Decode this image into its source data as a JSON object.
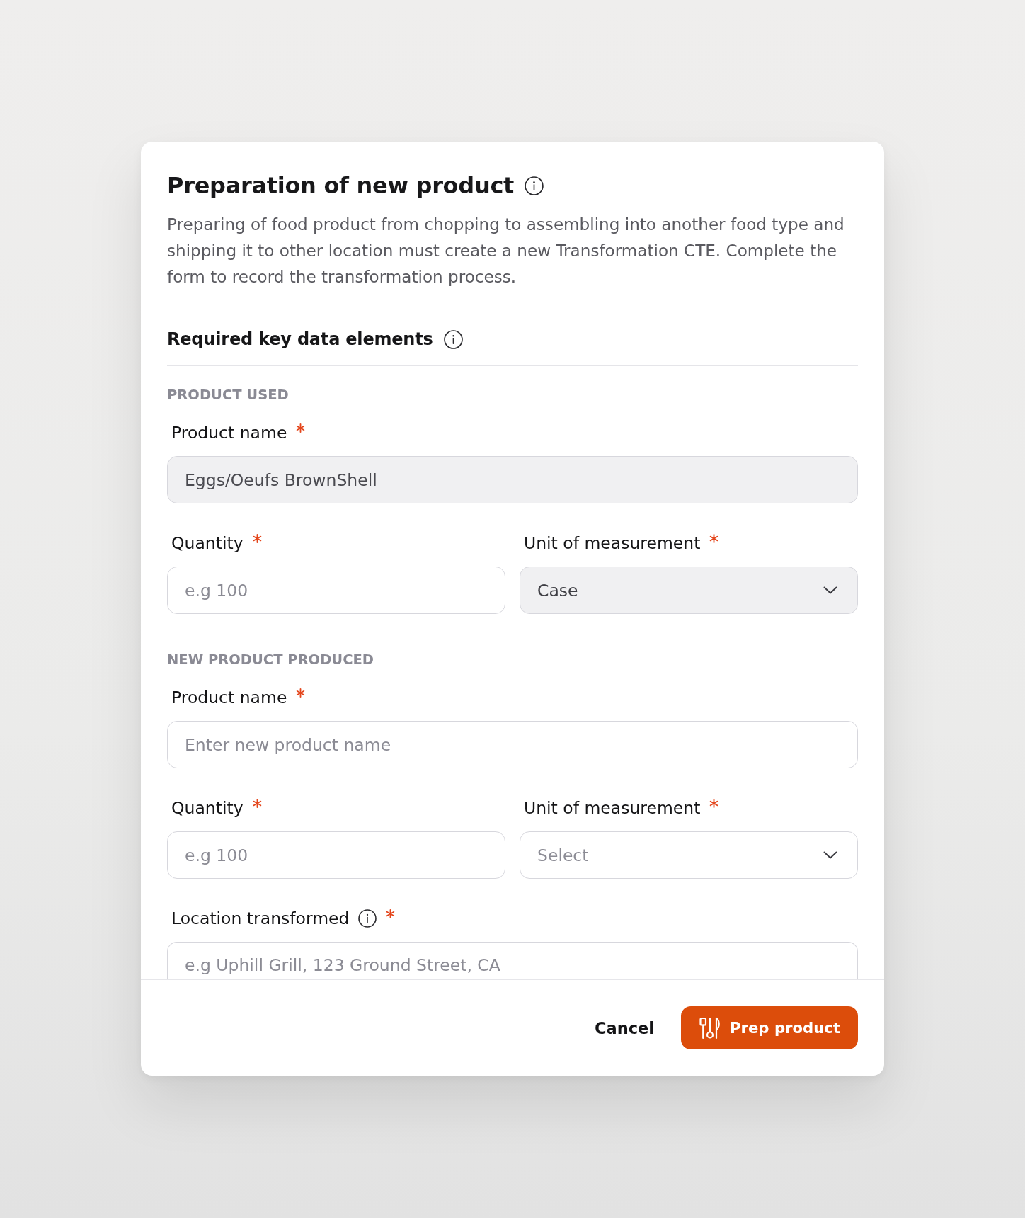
{
  "dialog": {
    "title": "Preparation of new product",
    "description": "Preparing of food product from chopping to assembling into another food type and shipping it to other location must create a new Transformation CTE. Complete the form to record the transformation process.",
    "section_title": "Required key data elements",
    "groups": [
      {
        "heading": "PRODUCT USED",
        "rows": [
          [
            {
              "kind": "text",
              "label": "Product name",
              "required": true,
              "info": false,
              "value": "Eggs/Oeufs BrownShell",
              "disabled": true
            }
          ],
          [
            {
              "kind": "text",
              "label": "Quantity",
              "required": true,
              "info": false,
              "placeholder": "e.g 100",
              "disabled": false
            },
            {
              "kind": "select",
              "label": "Unit of measurement",
              "required": true,
              "info": false,
              "value": "Case",
              "disabled": true
            }
          ]
        ]
      },
      {
        "heading": "NEW PRODUCT PRODUCED",
        "rows": [
          [
            {
              "kind": "text",
              "label": "Product name",
              "required": true,
              "info": false,
              "placeholder": "Enter new product name",
              "disabled": false
            }
          ],
          [
            {
              "kind": "text",
              "label": "Quantity",
              "required": true,
              "info": false,
              "placeholder": "e.g 100",
              "disabled": false
            },
            {
              "kind": "select",
              "label": "Unit of measurement",
              "required": true,
              "info": false,
              "placeholder": "Select",
              "disabled": false
            }
          ],
          [
            {
              "kind": "text",
              "label": "Location transformed",
              "required": true,
              "info": true,
              "placeholder": "e.g Uphill Grill, 123 Ground Street, CA",
              "disabled": false
            }
          ]
        ]
      }
    ]
  },
  "footer": {
    "buttons": [
      {
        "kind": "secondary",
        "label": "Cancel"
      },
      {
        "kind": "primary",
        "label": "Prep product"
      }
    ]
  }
}
